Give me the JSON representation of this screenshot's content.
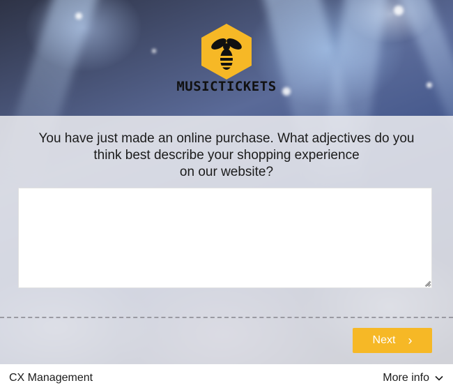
{
  "brand": {
    "name": "MUSICTICKETS",
    "logo_icon": "bee-icon",
    "logo_color": "#F6B826"
  },
  "survey": {
    "question_lines": [
      "You have just made an online purchase. What adjectives do you",
      "think best describe your shopping experience",
      "on our website?"
    ],
    "answer_value": "",
    "answer_placeholder": ""
  },
  "actions": {
    "next_label": "Next",
    "next_icon": "chevron-right-icon",
    "accent_color": "#F6B826"
  },
  "footer": {
    "left_label": "CX Management",
    "right_label": "More info",
    "right_icon": "chevron-down-icon"
  }
}
